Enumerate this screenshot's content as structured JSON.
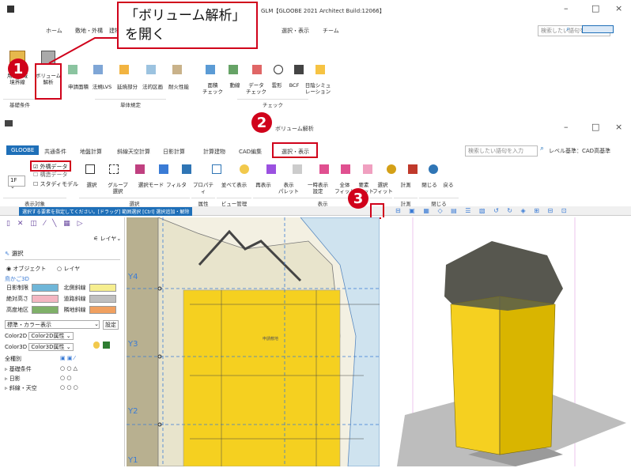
{
  "callout1": {
    "line1": "「ボリューム解析」",
    "line2": "を開く"
  },
  "top_window": {
    "title": "GLM【GLOOBE 2021 Architect Build:12066】",
    "search_placeholder": "検索したい語句を入力",
    "tabs": [
      "ホーム",
      "敷地・外構",
      "建物",
      "選択・表示",
      "チーム"
    ],
    "ribbon_buttons": [
      "用途地域\n境界線",
      "ボリューム\n解析",
      "申請面積",
      "法規LVS",
      "延焼部分",
      "法的区画",
      "耐火性能",
      "面積\nチェック",
      "動線",
      "データ\nチェック",
      "雲形",
      "BCF",
      "日陰シミュ\nレーション"
    ],
    "groups": [
      "基礎条件",
      "単体規定",
      "チェック"
    ]
  },
  "bottom_window": {
    "title": "ボリューム解析",
    "app_tab": "GLOOBE",
    "tabs": [
      "共通条件",
      "地盤計算",
      "斜線天空計算",
      "日影計算",
      "計算建物",
      "CAD編集",
      "選択・表示"
    ],
    "search_placeholder": "検索したい語句を入力",
    "level_label": "レベル基準：CAD高基準",
    "floor": "1F",
    "check_items": [
      "外構データ",
      "構造データ",
      "スタディモデル"
    ],
    "ribbon_buttons": [
      "選択",
      "グループ\n選択",
      "選択モード",
      "フィルタ",
      "プロパティ",
      "並べて表示",
      "再表示",
      "表示\nパレット",
      "一時表示\n設定",
      "全体\nフィット",
      "要素\nフィット",
      "選択\nフィット",
      "計測",
      "閉じる",
      "戻る"
    ],
    "groups": [
      "表示対象",
      "選択",
      "属性",
      "ビュー管理",
      "表示",
      "計測",
      "閉じる"
    ],
    "hint_bar": "選択する要素を指定してください。[ドラッグ] 範囲選択 [Ctrl] 選択追加・解除",
    "tooltip": "視点",
    "panel": {
      "title": "選択",
      "radio1": "オブジェクト",
      "radio2": "レイヤ",
      "section": "鳥かご3D",
      "rows": [
        [
          "日影制限",
          "北側斜線"
        ],
        [
          "絶対高さ",
          "道路斜線"
        ],
        [
          "高度地区",
          "隣地斜線"
        ]
      ],
      "display_mode": "標準・カラー表示",
      "settings": "設定",
      "color2d_label": "Color2D",
      "color2d_value": "Color2D属性",
      "color3d_label": "Color3D",
      "color3d_value": "Color3D属性",
      "tree_header": "全種別",
      "tree_items": [
        "基礎条件",
        "日影",
        "斜線・天空"
      ],
      "layer_btn": "レイヤ"
    },
    "grid_labels": [
      "Y4",
      "Y3",
      "Y2",
      "Y1"
    ],
    "plan_label": "申請敷地"
  },
  "colors": {
    "accent_red": "#d0021b",
    "ribbon_blue": "#1e6fb8",
    "swatch_blue": "#6fb6d8",
    "swatch_yellow": "#f6ee8f",
    "swatch_pink": "#f4b6c2",
    "swatch_gray": "#bfbfbf",
    "swatch_green": "#7fb069",
    "swatch_orange": "#f0a060",
    "building_yellow": "#f5d020"
  }
}
